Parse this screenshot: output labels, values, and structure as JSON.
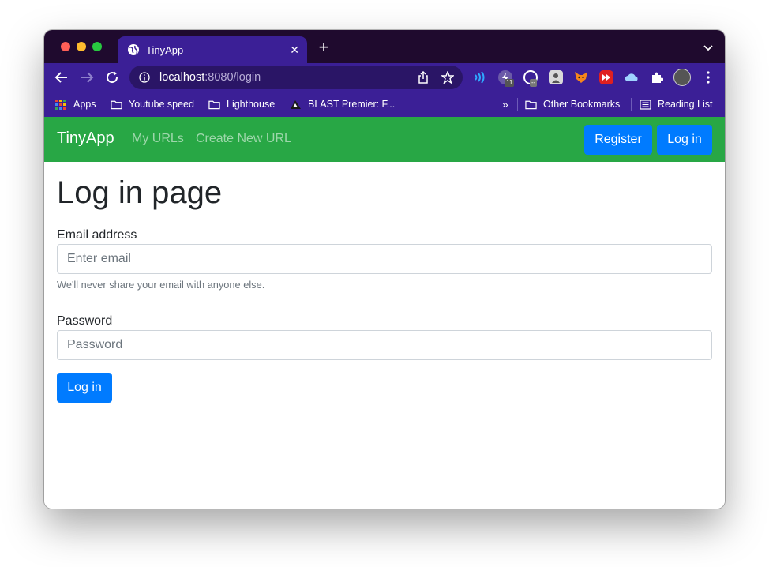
{
  "browser": {
    "tab_title": "TinyApp",
    "url_host": "localhost",
    "url_path": ":8080/login",
    "extension_badges": [
      "11",
      "--"
    ],
    "bookmarks": [
      "Apps",
      "Youtube speed",
      "Lighthouse",
      "BLAST Premier: F..."
    ],
    "bookmarks_overflow": "»",
    "other_bookmarks": "Other Bookmarks",
    "reading_list": "Reading List"
  },
  "app": {
    "brand": "TinyApp",
    "nav_links": [
      "My URLs",
      "Create New URL"
    ],
    "register_label": "Register",
    "login_nav_label": "Log in"
  },
  "form": {
    "heading": "Log in page",
    "email_label": "Email address",
    "email_placeholder": "Enter email",
    "email_help": "We'll never share your email with anyone else.",
    "password_label": "Password",
    "password_placeholder": "Password",
    "submit_label": "Log in"
  },
  "colors": {
    "navbar": "#28a745",
    "primary": "#007bff",
    "browser_frame": "#3b1f96"
  }
}
